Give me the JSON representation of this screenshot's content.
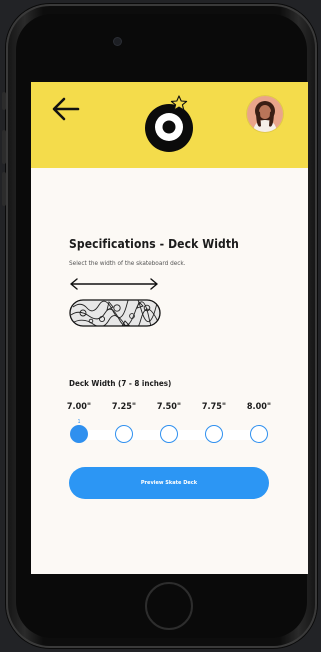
{
  "header": {
    "background_color": "#f4dc4b",
    "back_icon": "arrow-left-icon",
    "logo_icon": "eight-ball-with-star-logo",
    "avatar_icon": "user-avatar"
  },
  "spec": {
    "title": "Specifications - Deck Width",
    "subtitle": "Select the width of the skateboard deck."
  },
  "width_selector": {
    "label": "Deck Width (7 - 8 inches)",
    "options": [
      "7.00\"",
      "7.25\"",
      "7.50\"",
      "7.75\"",
      "8.00\""
    ],
    "selected_index": 0,
    "selected_mark": "1",
    "accent_color": "#2f90ef"
  },
  "actions": {
    "preview_label": "Preview Skate Deck",
    "button_color": "#2c96f4"
  }
}
